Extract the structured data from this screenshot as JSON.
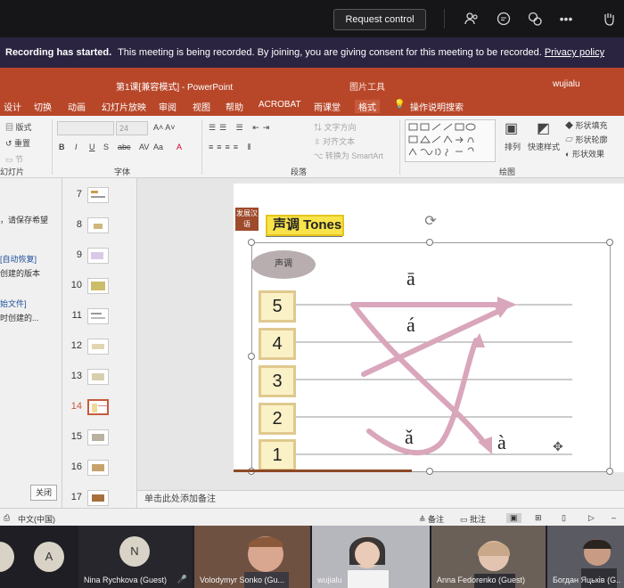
{
  "teams": {
    "request_control": "Request control",
    "icons": [
      "people-icon",
      "chat-icon",
      "reactions-icon",
      "more-icon"
    ],
    "more_glyph": "•••"
  },
  "banner": {
    "bold": "Recording has started.",
    "text": "This meeting is being recorded. By joining, you are giving consent for this meeting to be recorded.",
    "link": "Privacy policy"
  },
  "ppt": {
    "doc_title": "第1课[兼容模式] - PowerPoint",
    "tools_title": "图片工具",
    "user": "wujialu",
    "tabs": [
      "设计",
      "切换",
      "动画",
      "幻灯片放映",
      "审阅",
      "视图",
      "帮助",
      "ACROBAT",
      "雨课堂",
      "格式"
    ],
    "tell_me": "操作说明搜索",
    "ribbon": {
      "slides_group": "幻灯片",
      "font_group": "字体",
      "paragraph_group": "段落",
      "drawing_group": "绘图",
      "layout": "版式",
      "reset": "重置",
      "section": "节",
      "font_size": "24",
      "text_direction": "文字方向",
      "align_text": "对齐文本",
      "convert_smartart": "转换为 SmartArt",
      "arrange": "排列",
      "quick_styles": "快速样式",
      "shape_fill": "形状填充",
      "shape_outline": "形状轮廓",
      "shape_effects": "形状效果"
    },
    "left_pane": {
      "line1": "，请保存希望",
      "line2": "[自动恢复]",
      "line3": "创建的版本",
      "line4": "始文件]",
      "line5": "时创建的...",
      "close": "关闭"
    },
    "thumbs": [
      "7",
      "8",
      "9",
      "10",
      "11",
      "12",
      "13",
      "14",
      "15",
      "16",
      "17"
    ],
    "selected_thumb": "14",
    "notes_placeholder": "单击此处添加备注",
    "status": {
      "language": "中文(中国)",
      "notes": "备注",
      "comments": "批注"
    }
  },
  "slide": {
    "badge": "发展汉语",
    "heading": "声调 Tones",
    "ellipse": "声调",
    "tone_numbers": [
      "5",
      "4",
      "3",
      "2",
      "1"
    ],
    "pinyin": {
      "first": "ā",
      "second": "á",
      "third": "ǎ",
      "fourth": "à"
    },
    "arrow_color": "#d9a6bb"
  },
  "participants": [
    {
      "initial": "A",
      "name": ""
    },
    {
      "initial": "N",
      "name": "Nina Rychkova (Guest)"
    },
    {
      "initial": "",
      "name": "Volodymyr Sonko (Gu..."
    },
    {
      "initial": "",
      "name": "wujialu"
    },
    {
      "initial": "",
      "name": "Anna Fedorenko (Guest)"
    },
    {
      "initial": "",
      "name": "Богдан Яцьків (G..."
    }
  ]
}
